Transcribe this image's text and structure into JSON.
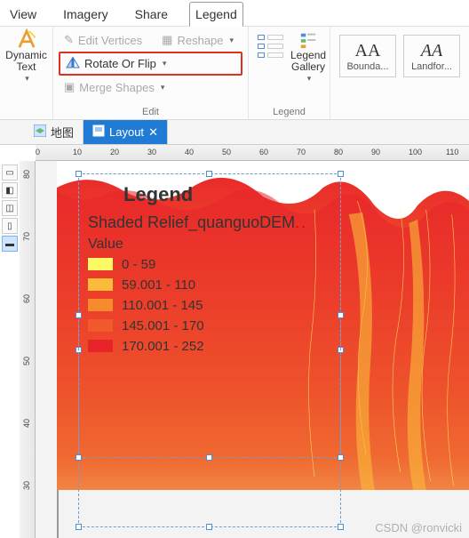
{
  "tabs": {
    "view": "View",
    "imagery": "Imagery",
    "share": "Share",
    "legend": "Legend"
  },
  "ribbon": {
    "dynamic_text": "Dynamic Text",
    "edit_vertices": "Edit Vertices",
    "reshape": "Reshape",
    "rotate_or_flip": "Rotate Or Flip",
    "merge_shapes": "Merge Shapes",
    "edit_label": "Edit",
    "legend_gallery": "Legend Gallery",
    "legend_label": "Legend",
    "text_style1": "Bounda...",
    "text_style2": "Landfor..."
  },
  "doc_tabs": {
    "map": "地图",
    "layout": "Layout"
  },
  "legend": {
    "title": "Legend",
    "layer": "Shaded Relief_quanguoDEM",
    "value_label": "Value",
    "items": [
      {
        "label": "0 - 59",
        "color": "#fdf965"
      },
      {
        "label": "59.001 - 110",
        "color": "#fabc3a"
      },
      {
        "label": "110.001 - 145",
        "color": "#f68b2e"
      },
      {
        "label": "145.001 - 170",
        "color": "#f05a2c"
      },
      {
        "label": "170.001 - 252",
        "color": "#e8242a"
      }
    ]
  },
  "ruler_h": [
    "0",
    "10",
    "20",
    "30",
    "40",
    "50",
    "60",
    "70",
    "80",
    "90",
    "100",
    "110"
  ],
  "ruler_v": [
    "80",
    "70",
    "60",
    "50",
    "40",
    "30"
  ],
  "watermark": "CSDN @ronvicki"
}
